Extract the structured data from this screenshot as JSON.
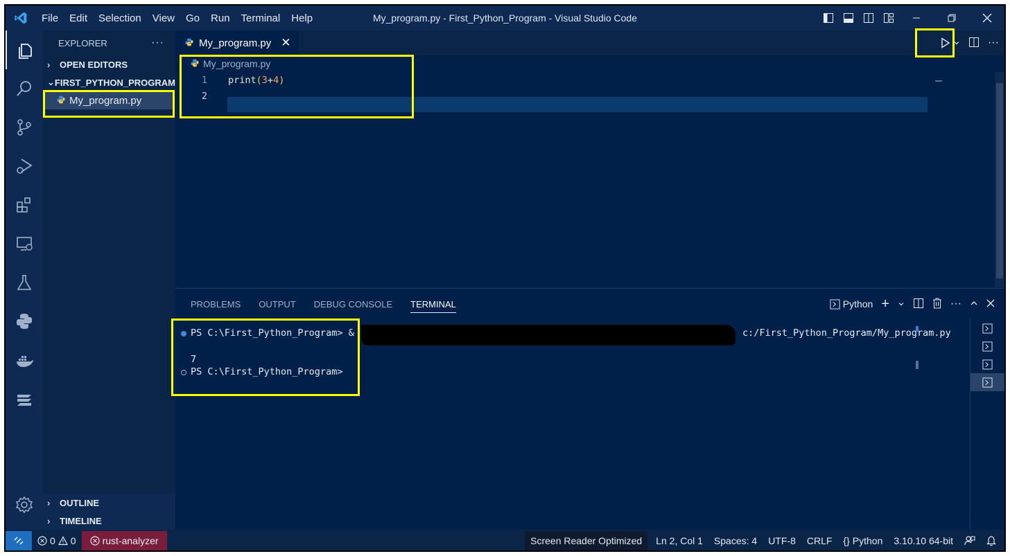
{
  "titlebar": {
    "menu": [
      "File",
      "Edit",
      "Selection",
      "View",
      "Go",
      "Run",
      "Terminal",
      "Help"
    ],
    "title": "My_program.py - First_Python_Program - Visual Studio Code"
  },
  "sidebar": {
    "header": "EXPLORER",
    "open_editors": "OPEN EDITORS",
    "folder": "FIRST_PYTHON_PROGRAM",
    "file": "My_program.py",
    "outline": "OUTLINE",
    "timeline": "TIMELINE"
  },
  "editor": {
    "tab_label": "My_program.py",
    "breadcrumb": "My_program.py",
    "lines": [
      {
        "num": "1",
        "fn": "print",
        "open": "(",
        "a": "3",
        "op": "+",
        "b": "4",
        "close": ")"
      },
      {
        "num": "2"
      }
    ]
  },
  "panel": {
    "tabs": [
      "PROBLEMS",
      "OUTPUT",
      "DEBUG CONSOLE",
      "TERMINAL"
    ],
    "shell": "Python",
    "terminal": {
      "cmd_prompt": "PS C:\\First_Python_Program> &",
      "cmd_path": "c:/First_Python_Program/My_program.py",
      "output": "7",
      "prompt2": "PS C:\\First_Python_Program>"
    }
  },
  "statusbar": {
    "errors": "0",
    "warnings": "0",
    "rust": "rust-analyzer",
    "screen_reader": "Screen Reader Optimized",
    "position": "Ln 2, Col 1",
    "spaces": "Spaces: 4",
    "encoding": "UTF-8",
    "eol": "CRLF",
    "language": "Python",
    "interpreter": "3.10.10 64-bit"
  },
  "colors": {
    "highlight": "#ffff00",
    "editor_bg": "#00204a",
    "remote": "#1f6fc0",
    "rust_badge": "#7a1c3c"
  }
}
